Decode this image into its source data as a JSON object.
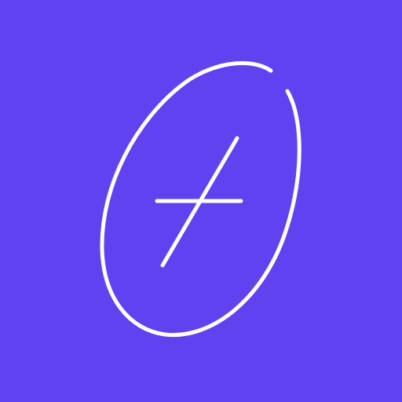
{
  "icon": {
    "name": "add-logo-icon",
    "background_color": "#6142f1",
    "stroke_color": "#ffffff"
  }
}
